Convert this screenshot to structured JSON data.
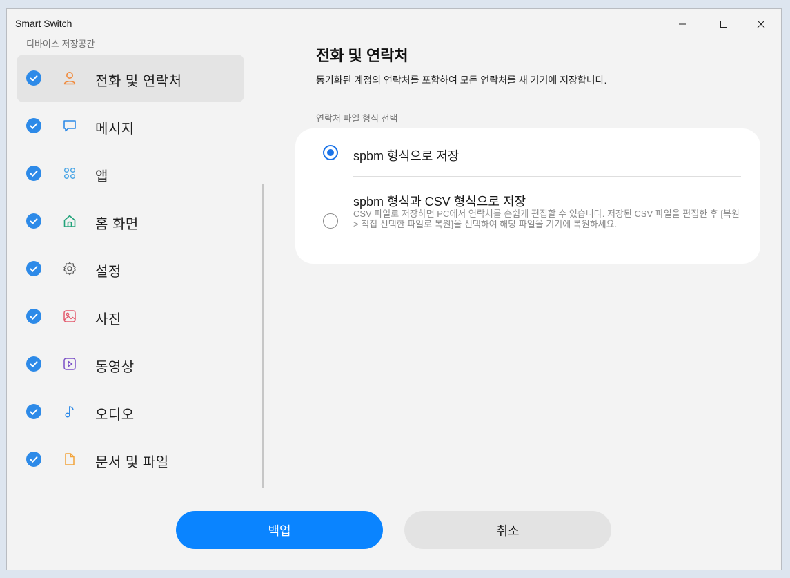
{
  "window": {
    "title": "Smart Switch"
  },
  "sidebar": {
    "caption": "디바이스 저장공간",
    "items": [
      {
        "label": "전화 및 연락처",
        "icon": "person-icon",
        "checked": true,
        "selected": true,
        "color": "#f08a3c"
      },
      {
        "label": "메시지",
        "icon": "message-icon",
        "checked": true,
        "color": "#2d8ae8"
      },
      {
        "label": "앱",
        "icon": "apps-icon",
        "checked": true,
        "color": "#4ba6e6"
      },
      {
        "label": "홈 화면",
        "icon": "home-icon",
        "checked": true,
        "color": "#22a37a"
      },
      {
        "label": "설정",
        "icon": "gear-icon",
        "checked": true,
        "color": "#5a5a5a"
      },
      {
        "label": "사진",
        "icon": "image-icon",
        "checked": true,
        "color": "#e35a6d"
      },
      {
        "label": "동영상",
        "icon": "video-icon",
        "checked": true,
        "color": "#7a4fc7"
      },
      {
        "label": "오디오",
        "icon": "music-icon",
        "checked": true,
        "color": "#2d8ae8"
      },
      {
        "label": "문서 및 파일",
        "icon": "document-icon",
        "checked": true,
        "color": "#f2a33a"
      }
    ]
  },
  "content": {
    "title": "전화 및 연락처",
    "description": "동기화된 계정의 연락처를 포함하여 모든 연락처를 새 기기에 저장합니다.",
    "section_label": "연락처 파일 형식 선택",
    "options": [
      {
        "label": "spbm 형식으로 저장",
        "selected": true
      },
      {
        "label": "spbm 형식과 CSV 형식으로 저장",
        "description": "CSV 파일로 저장하면 PC에서 연락처를 손쉽게 편집할 수 있습니다. 저장된 CSV 파일을 편집한 후 [복원 > 직접 선택한 파일로 복원]을 선택하여 해당 파일을 기기에 복원하세요.",
        "selected": false
      }
    ]
  },
  "buttons": {
    "backup": "백업",
    "cancel": "취소"
  },
  "colors": {
    "accent": "#0a84ff",
    "check": "#2d8ae8"
  }
}
